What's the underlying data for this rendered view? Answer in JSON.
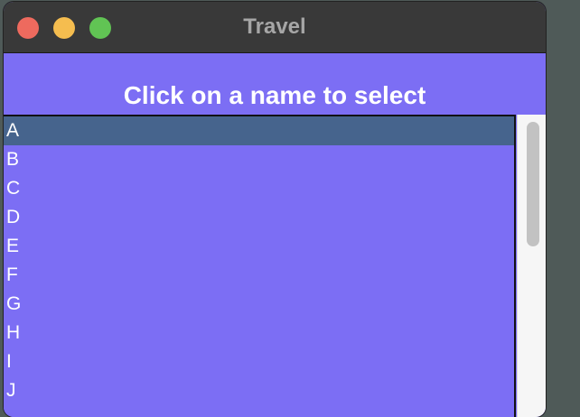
{
  "window": {
    "title": "Travel"
  },
  "main": {
    "heading": "Click on a name to select",
    "list": {
      "items": [
        "A",
        "B",
        "C",
        "D",
        "E",
        "F",
        "G",
        "H",
        "I",
        "J"
      ],
      "selected_index": 0
    }
  },
  "colors": {
    "content_background": "#7c6ef4",
    "selected_row": "#46648d",
    "title_bar": "#393939"
  },
  "icons": {
    "close": "close-traffic-light",
    "minimize": "minimize-traffic-light",
    "maximize": "maximize-traffic-light"
  }
}
